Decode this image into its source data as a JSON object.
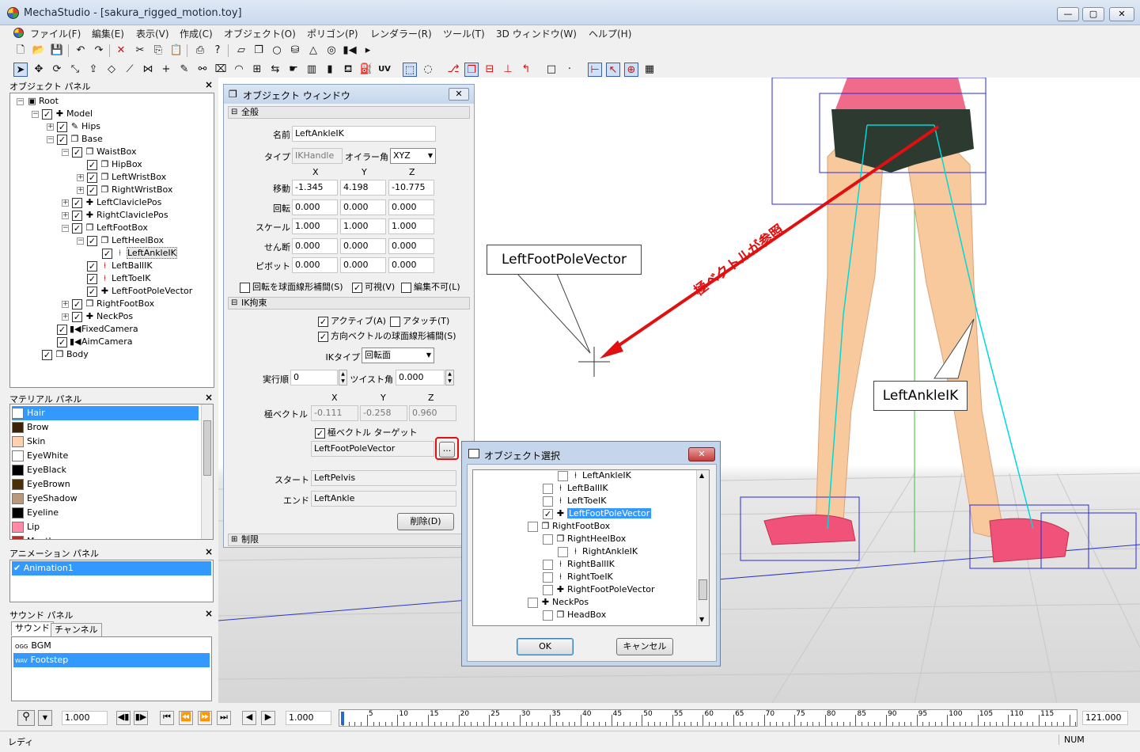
{
  "app": {
    "title": "MechaStudio - [sakura_rigged_motion.toy]",
    "win_min": "—",
    "win_max": "▢",
    "win_close": "✕"
  },
  "menu": [
    "ファイル(F)",
    "編集(E)",
    "表示(V)",
    "作成(C)",
    "オブジェクト(O)",
    "ポリゴン(P)",
    "レンダラー(R)",
    "ツール(T)",
    "3D ウィンドウ(W)",
    "ヘルプ(H)"
  ],
  "toolbar": {
    "row1_icons": [
      "new-icon",
      "open-icon",
      "save-icon",
      "undo-icon",
      "redo-icon",
      "delete-icon",
      "cut-icon",
      "copy-icon",
      "paste-icon",
      "print-icon",
      "help-icon",
      "box-icon",
      "cube-icon",
      "sphere-icon",
      "cylinder-icon",
      "cone-icon",
      "torus-icon",
      "camera-icon",
      "light-icon"
    ],
    "uv_label": "UV"
  },
  "object_panel": {
    "title": "オブジェクト パネル",
    "tree": [
      {
        "label": "Root",
        "icon": "root-icon",
        "depth": 0,
        "checkbox": false,
        "expander": "minus"
      },
      {
        "label": "Model",
        "icon": "null-icon",
        "depth": 1,
        "checkbox": true,
        "expander": "minus"
      },
      {
        "label": "Hips",
        "icon": "bone-icon",
        "depth": 2,
        "checkbox": true,
        "expander": "plus"
      },
      {
        "label": "Base",
        "icon": "box-icon",
        "depth": 2,
        "checkbox": true,
        "expander": "minus"
      },
      {
        "label": "WaistBox",
        "icon": "box-icon",
        "depth": 3,
        "checkbox": true,
        "expander": "minus"
      },
      {
        "label": "HipBox",
        "icon": "box-icon",
        "depth": 4,
        "checkbox": true,
        "expander": ""
      },
      {
        "label": "LeftWristBox",
        "icon": "box-icon",
        "depth": 4,
        "checkbox": true,
        "expander": "plus"
      },
      {
        "label": "RightWristBox",
        "icon": "box-icon",
        "depth": 4,
        "checkbox": true,
        "expander": "plus"
      },
      {
        "label": "LeftClaviclePos",
        "icon": "null-icon",
        "depth": 3,
        "checkbox": true,
        "expander": "plus"
      },
      {
        "label": "RightClaviclePos",
        "icon": "null-icon",
        "depth": 3,
        "checkbox": true,
        "expander": "plus"
      },
      {
        "label": "LeftFootBox",
        "icon": "box-icon",
        "depth": 3,
        "checkbox": true,
        "expander": "minus"
      },
      {
        "label": "LeftHeelBox",
        "icon": "box-icon",
        "depth": 4,
        "checkbox": true,
        "expander": "minus"
      },
      {
        "label": "LeftAnkleIK",
        "icon": "ik-icon",
        "depth": 5,
        "checkbox": true,
        "expander": "",
        "selected": true
      },
      {
        "label": "LeftBallIK",
        "icon": "ik-icon",
        "depth": 4,
        "checkbox": true,
        "expander": ""
      },
      {
        "label": "LeftToeIK",
        "icon": "ik-icon",
        "depth": 4,
        "checkbox": true,
        "expander": ""
      },
      {
        "label": "LeftFootPoleVector",
        "icon": "null-icon",
        "depth": 4,
        "checkbox": true,
        "expander": ""
      },
      {
        "label": "RightFootBox",
        "icon": "box-icon",
        "depth": 3,
        "checkbox": true,
        "expander": "plus"
      },
      {
        "label": "NeckPos",
        "icon": "null-icon",
        "depth": 3,
        "checkbox": true,
        "expander": "plus"
      },
      {
        "label": "FixedCamera",
        "icon": "camera-icon",
        "depth": 2,
        "checkbox": true,
        "expander": ""
      },
      {
        "label": "AimCamera",
        "icon": "camera-icon",
        "depth": 2,
        "checkbox": true,
        "expander": ""
      },
      {
        "label": "Body",
        "icon": "box-icon",
        "depth": 1,
        "checkbox": true,
        "expander": ""
      }
    ]
  },
  "material_panel": {
    "title": "マテリアル パネル",
    "items": [
      {
        "name": "Hair",
        "color": "#ffffff",
        "selected": true
      },
      {
        "name": "Brow",
        "color": "#3b2106"
      },
      {
        "name": "Skin",
        "color": "#ffd1b0"
      },
      {
        "name": "EyeWhite",
        "color": "#ffffff"
      },
      {
        "name": "EyeBlack",
        "color": "#000000"
      },
      {
        "name": "EyeBrown",
        "color": "#4a3008"
      },
      {
        "name": "EyeShadow",
        "color": "#b8987e"
      },
      {
        "name": "Eyeline",
        "color": "#000000"
      },
      {
        "name": "Lip",
        "color": "#ff8aa8"
      },
      {
        "name": "Mouth",
        "color": "#b03030"
      }
    ]
  },
  "animation_panel": {
    "title": "アニメーション パネル",
    "items": [
      {
        "name": "Animation1",
        "selected": true
      }
    ]
  },
  "sound_panel": {
    "title": "サウンド パネル",
    "tabs": [
      "サウンド",
      "チャンネル"
    ],
    "items": [
      {
        "tag": "OGG",
        "name": "BGM"
      },
      {
        "tag": "WAV",
        "name": "Footstep",
        "selected": true
      }
    ]
  },
  "object_window": {
    "title": "オブジェクト ウィンドウ",
    "section_general": "全般",
    "name_label": "名前",
    "name_value": "LeftAnkleIK",
    "type_label": "タイプ",
    "type_value": "IKHandle",
    "euler_label": "オイラー角",
    "euler_value": "XYZ",
    "axis_x": "X",
    "axis_y": "Y",
    "axis_z": "Z",
    "transform_rows": [
      {
        "label": "移動",
        "x": "-1.345",
        "y": "4.198",
        "z": "-10.775"
      },
      {
        "label": "回転",
        "x": "0.000",
        "y": "0.000",
        "z": "0.000"
      },
      {
        "label": "スケール",
        "x": "1.000",
        "y": "1.000",
        "z": "1.000"
      },
      {
        "label": "せん断",
        "x": "0.000",
        "y": "0.000",
        "z": "0.000"
      },
      {
        "label": "ピボット",
        "x": "0.000",
        "y": "0.000",
        "z": "0.000"
      }
    ],
    "slerp_label": "回転を球面線形補間(S)",
    "visible_label": "可視(V)",
    "locked_label": "編集不可(L)",
    "section_ik": "IK拘束",
    "active_label": "アクティブ(A)",
    "attach_label": "アタッチ(T)",
    "dir_slerp_label": "方向ベクトルの球面線形補間(S)",
    "iktype_label": "IKタイプ",
    "iktype_value": "回転面",
    "order_label": "実行順",
    "order_value": "0",
    "twist_label": "ツイスト角",
    "twist_value": "0.000",
    "pole_label": "極ベクトル",
    "pole_x": "-0.111",
    "pole_y": "-0.258",
    "pole_z": "0.960",
    "pole_target_label": "極ベクトル ターゲット",
    "pole_target_value": "LeftFootPoleVector",
    "browse_label": "...",
    "start_label": "スタート",
    "start_value": "LeftPelvis",
    "end_label": "エンド",
    "end_value": "LeftAnkle",
    "delete_label": "削除(D)",
    "section_limit": "制限"
  },
  "select_dialog": {
    "title": "オブジェクト選択",
    "rows": [
      {
        "label": "LeftAnkleIK",
        "icon": "ik-icon",
        "depth": 3,
        "checked": false
      },
      {
        "label": "LeftBallIK",
        "icon": "ik-icon",
        "depth": 2,
        "checked": false
      },
      {
        "label": "LeftToeIK",
        "icon": "ik-icon",
        "depth": 2,
        "checked": false
      },
      {
        "label": "LeftFootPoleVector",
        "icon": "null-icon",
        "depth": 2,
        "checked": true,
        "selected": true
      },
      {
        "label": "RightFootBox",
        "icon": "box-icon",
        "depth": 1,
        "checked": false
      },
      {
        "label": "RightHeelBox",
        "icon": "box-icon",
        "depth": 2,
        "checked": false
      },
      {
        "label": "RightAnkleIK",
        "icon": "ik-icon",
        "depth": 3,
        "checked": false
      },
      {
        "label": "RightBallIK",
        "icon": "ik-icon",
        "depth": 2,
        "checked": false
      },
      {
        "label": "RightToeIK",
        "icon": "ik-icon",
        "depth": 2,
        "checked": false
      },
      {
        "label": "RightFootPoleVector",
        "icon": "null-icon",
        "depth": 2,
        "checked": false
      },
      {
        "label": "NeckPos",
        "icon": "null-icon",
        "depth": 1,
        "checked": false
      },
      {
        "label": "HeadBox",
        "icon": "box-icon",
        "depth": 2,
        "checked": false
      }
    ],
    "ok_label": "OK",
    "cancel_label": "キャンセル"
  },
  "viewport": {
    "callout_pole": "LeftFootPoleVector",
    "callout_ankle": "LeftAnkleIK",
    "annotation": "極ベクトルが参照",
    "arrow_color": "#e01010"
  },
  "timeline": {
    "speed_value": "1.000",
    "frame_value": "1.000",
    "end_value": "121.000",
    "ticks": [
      "5",
      "10",
      "15",
      "20",
      "25",
      "30",
      "35",
      "40",
      "45",
      "50",
      "55",
      "60",
      "65",
      "70",
      "75",
      "80",
      "85",
      "90",
      "95",
      "100",
      "105",
      "110",
      "115"
    ]
  },
  "status": {
    "text": "レディ",
    "num": "NUM"
  }
}
